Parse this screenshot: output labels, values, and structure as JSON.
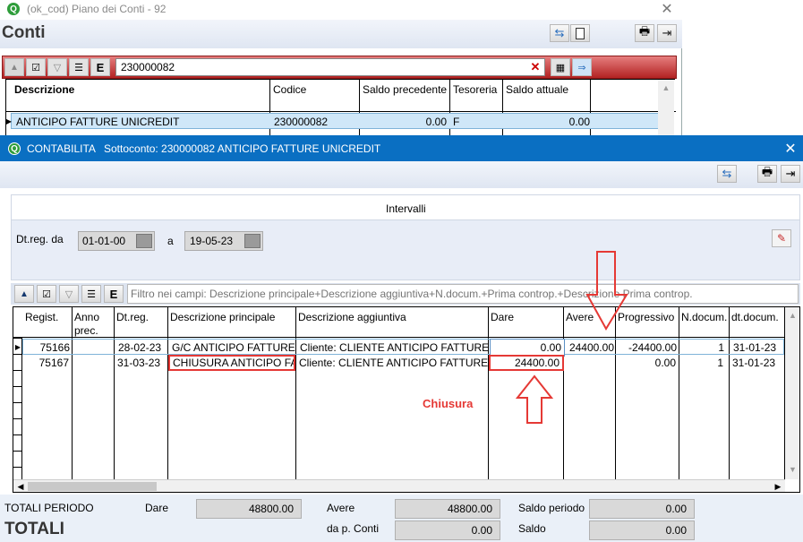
{
  "back_window": {
    "title": "(ok_cod) Piano dei Conti - 92",
    "heading": "Conti",
    "search_value": "230000082",
    "columns": [
      "Descrizione",
      "Codice",
      "Saldo precedente",
      "Tesoreria",
      "Saldo attuale"
    ],
    "row": {
      "descrizione": "ANTICIPO FATTURE UNICREDIT",
      "codice": "230000082",
      "saldo_precedente": "0.00",
      "tesoreria": "F",
      "saldo_attuale": "0.00"
    }
  },
  "front_window": {
    "title": "CONTABILITA",
    "subtitle": "Sottoconto: 230000082 ANTICIPO FATTURE UNICREDIT",
    "intervals_title": "Intervalli",
    "dtreg_label": "Dt.reg. da",
    "date_from": "01-01-00",
    "a_label": "a",
    "date_to": "19-05-23",
    "filter_placeholder": "Filtro nei campi: Descrizione principale+Descrizione aggiuntiva+N.docum.+Prima controp.+Descrizione Prima controp.",
    "columns": [
      "Regist.",
      "Anno prec.",
      "Dt.reg.",
      "Descrizione principale",
      "Descrizione aggiuntiva",
      "Dare",
      "Avere",
      "Progressivo",
      "N.docum.",
      "dt.docum."
    ],
    "rows": [
      {
        "regist": "75166",
        "anno": "",
        "dtreg": "28-02-23",
        "desc": "G/C ANTICIPO FATTURE",
        "desc_agg": "Cliente: CLIENTE ANTICIPO FATTURE",
        "dare": "0.00",
        "avere": "24400.00",
        "progressivo": "-24400.00",
        "ndoc": "1",
        "dtdoc": "31-01-23"
      },
      {
        "regist": "75167",
        "anno": "",
        "dtreg": "31-03-23",
        "desc": "CHIUSURA ANTICIPO FATTURE",
        "desc_agg": "Cliente: CLIENTE ANTICIPO FATTURE",
        "dare": "24400.00",
        "avere": "",
        "progressivo": "0.00",
        "ndoc": "1",
        "dtdoc": "31-01-23"
      }
    ],
    "annotation": "Chiusura",
    "totals": {
      "totali_periodo": "TOTALI PERIODO",
      "totali": "TOTALI",
      "dare_label": "Dare",
      "dare_value": "48800.00",
      "avere_label": "Avere",
      "avere_value": "48800.00",
      "da_p_conti_label": "da p. Conti",
      "da_p_conti_value": "0.00",
      "saldo_periodo_label": "Saldo periodo",
      "saldo_periodo_value": "0.00",
      "saldo_label": "Saldo",
      "saldo_value": "0.00"
    }
  },
  "colors": {
    "accent_red": "#e53935",
    "selection": "#cfe7f8",
    "title_bar_active": "#0a6fc2"
  }
}
